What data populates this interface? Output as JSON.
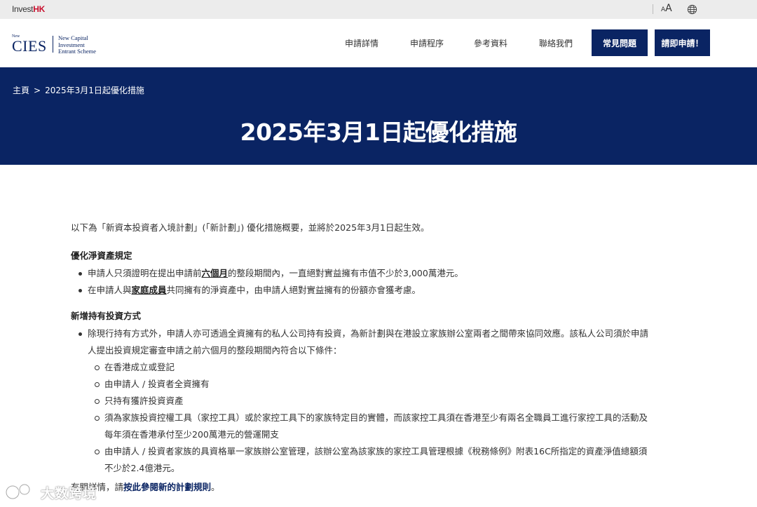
{
  "topbar": {
    "logo_prefix": "Invest",
    "logo_suffix": "HK",
    "font_size_small": "A",
    "font_size_large": "A"
  },
  "header": {
    "brand_new": "New",
    "brand_name": "CIES",
    "brand_sub": [
      "New Capital",
      "Investment",
      "Entrant Scheme"
    ],
    "nav": [
      "申請詳情",
      "申請程序",
      "參考資料",
      "聯絡我們"
    ],
    "faq_button": "常見問題",
    "apply_button": "請即申請！"
  },
  "banner": {
    "breadcrumb": [
      "主頁",
      ">",
      "2025年3月1日起優化措施"
    ],
    "title": "2025年3月1日起優化措施"
  },
  "content": {
    "intro": "以下為「新資本投資者入境計劃」(「新計劃」) 優化措施概要，並將於2025年3月1日起生效。",
    "section1": {
      "heading": "優化淨資產規定",
      "item1_pre": "申請人只須證明在提出申請前",
      "item1_link": "六個月",
      "item1_post": "的整段期間內，一直絕對實益擁有市值不少於3,000萬港元。",
      "item2_pre": "在申請人與",
      "item2_link": "家庭成員",
      "item2_post": "共同擁有的淨資產中，由申請人絕對實益擁有的份額亦會獲考慮。"
    },
    "section2": {
      "heading": "新增持有投資方式",
      "item1": "除現行持有方式外，申請人亦可透過全資擁有的私人公司持有投資，為新計劃與在港設立家族辦公室兩者之間帶來協同效應。該私人公司須於申請人提出投資規定審查申請之前六個月的整段期間內符合以下條件：",
      "sub": [
        "在香港成立或登記",
        "由申請人 / 投資者全資擁有",
        "只持有獲許投資資產",
        "須為家族投資控權工具（家控工具）或於家控工具下的家族特定目的實體，而該家控工具須在香港至少有兩名全職員工進行家控工具的活動及每年須在香港承付至少200萬港元的營運開支",
        "由申請人 / 投資者家族的具資格單一家族辦公室管理，該辦公室為該家族的家控工具管理根據《稅務條例》附表16C所指定的資產淨值總額須不少於2.4億港元。"
      ]
    },
    "footer_pre": "有關詳情，請",
    "footer_link": "按此參閱新的計劃規則",
    "footer_post": "。"
  },
  "watermark": {
    "text": "大数跨境"
  }
}
